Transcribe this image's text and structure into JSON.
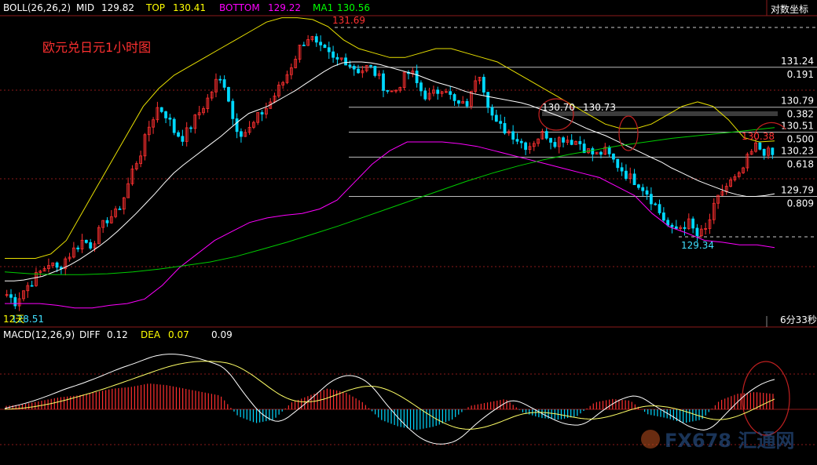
{
  "header": {
    "boll_label": "BOLL(26,26,2)",
    "mid_label": "MID",
    "mid_value": "129.82",
    "top_label": "TOP",
    "top_value": "130.41",
    "bottom_label": "BOTTOM",
    "bottom_value": "129.22",
    "ma1_label": "MA1",
    "ma1_value": "130.56",
    "axis_mode": "对数坐标"
  },
  "title": "欧元兑日元1小时图",
  "price_labels": {
    "high": "131.69",
    "low": "129.34",
    "left_low": "128.51",
    "left_tag": "12天",
    "peak1": "130.70",
    "peak2": "130.73",
    "recent": "130.38",
    "countdown": "6分33秒"
  },
  "fib_levels": [
    {
      "price": "131.24",
      "ratio": "0.191"
    },
    {
      "price": "130.79",
      "ratio": "0.382"
    },
    {
      "price": "130.51",
      "ratio": "0.500"
    },
    {
      "price": "130.23",
      "ratio": "0.618"
    },
    {
      "price": "129.79",
      "ratio": "0.809"
    }
  ],
  "macd": {
    "label": "MACD(12,26,9)",
    "diff_label": "DIFF",
    "diff_value": "0.12",
    "dea_label": "DEA",
    "dea_value": "0.07",
    "macd_value": "0.09"
  },
  "watermark": "FX678 汇通网",
  "colors": {
    "up": "#ff3030",
    "down": "#00d8ff",
    "mid": "#ffffff",
    "top": "#e8e000",
    "bottom": "#ff00ff",
    "ma1": "#00cc00",
    "grid": "#8b1a1a"
  },
  "chart_data": {
    "type": "candlestick",
    "timeframe": "1h",
    "y_axis_scale": "log",
    "ylim": [
      128.4,
      131.9
    ],
    "closes": [
      128.7,
      128.62,
      128.75,
      128.85,
      128.95,
      129.05,
      128.98,
      129.1,
      129.2,
      129.3,
      129.25,
      129.4,
      129.55,
      129.6,
      129.8,
      130.1,
      130.3,
      130.6,
      130.8,
      130.7,
      130.5,
      130.45,
      130.6,
      130.75,
      130.9,
      131.1,
      131.05,
      130.6,
      130.5,
      130.55,
      130.7,
      130.8,
      130.95,
      131.1,
      131.3,
      131.5,
      131.6,
      131.45,
      131.4,
      131.3,
      131.35,
      131.25,
      131.2,
      131.25,
      131.15,
      131.0,
      130.95,
      131.1,
      131.2,
      131.0,
      130.9,
      130.95,
      131.05,
      130.85,
      130.8,
      130.85,
      131.25,
      130.9,
      130.6,
      130.55,
      130.5,
      130.4,
      130.35,
      130.45,
      130.5,
      130.4,
      130.45,
      130.42,
      130.4,
      130.3,
      130.25,
      130.3,
      130.2,
      130.1,
      130.0,
      129.95,
      129.85,
      129.7,
      129.55,
      129.4,
      129.45,
      129.5,
      129.35,
      129.4,
      129.65,
      129.85,
      129.95,
      130.0,
      130.2,
      130.35,
      130.3,
      130.25
    ],
    "boll_mid": [
      128.85,
      128.85,
      128.86,
      128.88,
      128.9,
      128.94,
      128.98,
      129.03,
      129.09,
      129.16,
      129.23,
      129.31,
      129.4,
      129.5,
      129.6,
      129.71,
      129.82,
      129.94,
      130.05,
      130.14,
      130.22,
      130.3,
      130.38,
      130.46,
      130.55,
      130.64,
      130.72,
      130.76,
      130.8,
      130.86,
      130.92,
      130.98,
      131.05,
      131.12,
      131.19,
      131.25,
      131.29,
      131.3,
      131.3,
      131.29,
      131.27,
      131.24,
      131.21,
      131.18,
      131.15,
      131.11,
      131.07,
      131.04,
      131.01,
      130.97,
      130.94,
      130.92,
      130.9,
      130.88,
      130.86,
      130.84,
      130.81,
      130.77,
      130.73,
      130.69,
      130.65,
      130.6,
      130.55,
      130.51,
      130.47,
      130.42,
      130.37,
      130.32,
      130.27,
      130.22,
      130.17,
      130.11,
      130.06,
      130.01,
      129.96,
      129.92,
      129.88,
      129.84,
      129.81,
      129.79,
      129.79,
      129.8,
      129.82
    ],
    "boll_top": [
      129.1,
      129.1,
      129.1,
      129.15,
      129.3,
      129.6,
      129.9,
      130.2,
      130.5,
      130.8,
      131.0,
      131.15,
      131.25,
      131.35,
      131.45,
      131.55,
      131.65,
      131.75,
      131.8,
      131.8,
      131.78,
      131.7,
      131.55,
      131.45,
      131.4,
      131.35,
      131.35,
      131.4,
      131.45,
      131.45,
      131.4,
      131.35,
      131.3,
      131.2,
      131.1,
      131.0,
      130.9,
      130.8,
      130.7,
      130.6,
      130.55,
      130.55,
      130.6,
      130.7,
      130.8,
      130.85,
      130.8,
      130.65,
      130.45,
      130.4,
      130.41
    ],
    "boll_bottom": [
      128.6,
      128.6,
      128.6,
      128.58,
      128.55,
      128.55,
      128.58,
      128.6,
      128.65,
      128.8,
      129.0,
      129.15,
      129.3,
      129.4,
      129.5,
      129.55,
      129.58,
      129.6,
      129.65,
      129.75,
      129.95,
      130.15,
      130.3,
      130.4,
      130.4,
      130.4,
      130.38,
      130.35,
      130.3,
      130.25,
      130.2,
      130.15,
      130.1,
      130.05,
      130.0,
      129.9,
      129.8,
      129.6,
      129.45,
      129.38,
      129.3,
      129.28,
      129.25,
      129.25,
      129.22
    ],
    "ma1": [
      128.95,
      128.93,
      128.92,
      128.92,
      128.93,
      128.95,
      128.98,
      129.02,
      129.06,
      129.12,
      129.2,
      129.28,
      129.37,
      129.46,
      129.56,
      129.66,
      129.76,
      129.86,
      129.96,
      130.05,
      130.13,
      130.2,
      130.26,
      130.31,
      130.36,
      130.4,
      130.44,
      130.47,
      130.5,
      130.53,
      130.56
    ],
    "macd_histogram_sample": [
      0.02,
      0.03,
      0.05,
      0.07,
      0.08,
      0.1,
      0.12,
      0.13,
      0.15,
      0.14,
      0.12,
      0.1,
      0.08,
      -0.04,
      -0.08,
      -0.06,
      0.04,
      0.08,
      0.12,
      0.1,
      0.04,
      -0.06,
      -0.1,
      -0.12,
      -0.1,
      -0.06,
      0.02,
      0.04,
      0.06,
      -0.02,
      -0.05,
      -0.06,
      -0.04,
      0.04,
      0.06,
      0.05,
      -0.03,
      -0.05,
      -0.08,
      -0.06,
      0.05,
      0.09,
      0.1,
      0.09
    ],
    "xlabel": "",
    "ylabel": ""
  }
}
